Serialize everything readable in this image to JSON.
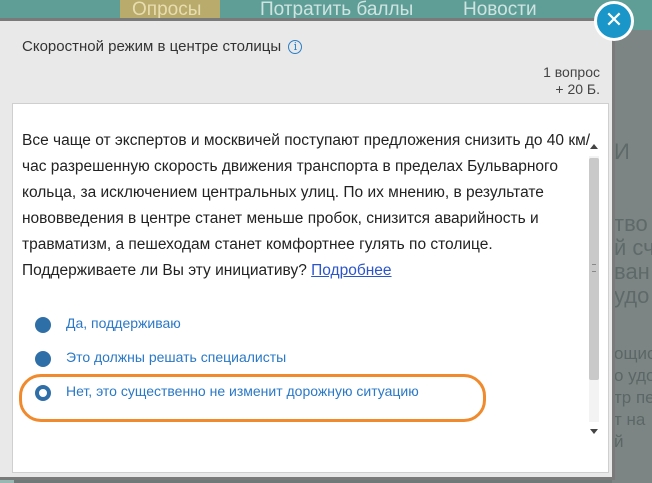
{
  "background": {
    "nav": [
      "Опросы",
      "Потратить баллы",
      "Новости"
    ],
    "right_fragments": [
      "И",
      "тво",
      "й сч",
      "ван",
      "удо",
      "ощис",
      "о удо",
      "тр пе",
      "т на",
      "й"
    ]
  },
  "modal": {
    "title": "Скоростной режим в центре столицы",
    "info_icon": "i",
    "meta_questions": "1 вопрос",
    "meta_points": "+ 20 Б.",
    "question_text": "Все чаще от экспертов и москвичей поступают предложения снизить до 40 км/час разрешенную скорость движения транспорта в пределах Бульварного кольца, за исключением центральных улиц. По их мнению, в результате нововведения в центре станет меньше пробок, снизится аварийность и травматизм, а пешеходам станет комфортнее гулять по столице. Поддерживаете ли Вы эту инициативу?",
    "more_link": "Подробнее",
    "options": [
      {
        "label": "Да, поддерживаю"
      },
      {
        "label": "Это должны решать специалисты"
      },
      {
        "label": "Нет, это существенно не изменит дорожную ситуацию"
      }
    ],
    "close": "✕"
  },
  "colors": {
    "accent": "#2a78c6",
    "highlight": "#f08a2c",
    "close_button": "#1a96c8"
  }
}
